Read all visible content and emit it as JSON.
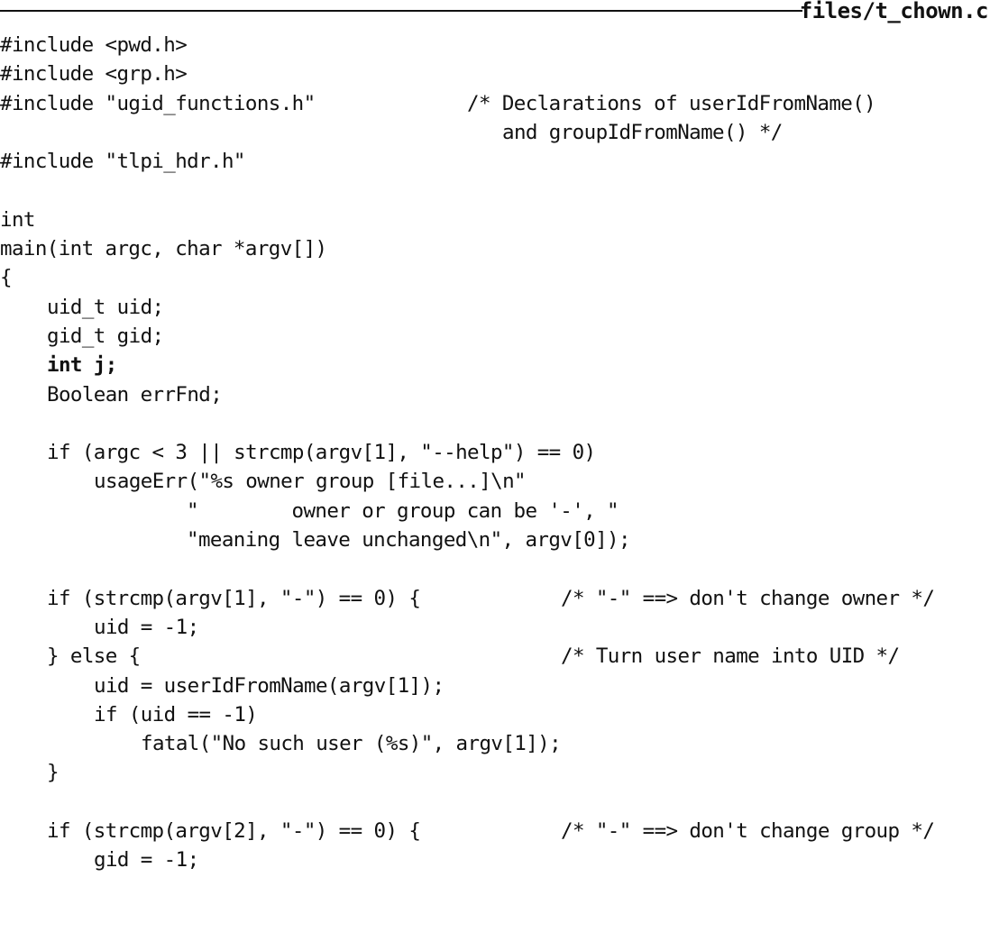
{
  "header": {
    "filename": "files/t_chown.c"
  },
  "code": {
    "l1": "#include <pwd.h>",
    "l2": "#include <grp.h>",
    "l3": "#include \"ugid_functions.h\"",
    "l3c": "/* Declarations of userIdFromName()",
    "l4c": "and groupIdFromName() */",
    "l5": "#include \"tlpi_hdr.h\"",
    "l7": "int",
    "l8": "main(int argc, char *argv[])",
    "l9": "{",
    "l10": "uid_t uid;",
    "l11": "gid_t gid;",
    "l12": "int j;",
    "l13": "Boolean errFnd;",
    "l15": "if (argc < 3 || strcmp(argv[1], \"--help\") == 0)",
    "l16": "usageErr(\"%s owner group [file...]\\n\"",
    "l17": "\"        owner or group can be '-', \"",
    "l18": "\"meaning leave unchanged\\n\", argv[0]);",
    "l20": "if (strcmp(argv[1], \"-\") == 0) {",
    "l20c": "/* \"-\" ==> don't change owner */",
    "l21": "uid = -1;",
    "l22": "} else {",
    "l22c": "/* Turn user name into UID */",
    "l23": "uid = userIdFromName(argv[1]);",
    "l24": "if (uid == -1)",
    "l25": "fatal(\"No such user (%s)\", argv[1]);",
    "l26": "}",
    "l28": "if (strcmp(argv[2], \"-\") == 0) {",
    "l28c": "/* \"-\" ==> don't change group */",
    "l29": "gid = -1;"
  }
}
